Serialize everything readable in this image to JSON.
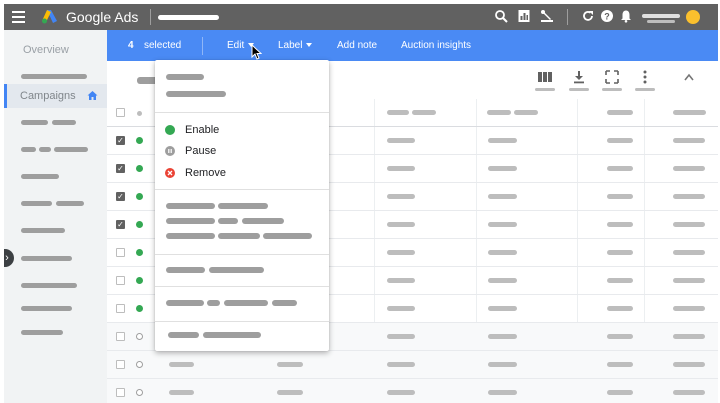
{
  "app": {
    "brand_name": "Google Ads"
  },
  "sidebar": {
    "overview_label": "Overview",
    "campaigns_label": "Campaigns"
  },
  "action_bar": {
    "selected_count": "4",
    "selected_label": "selected",
    "items": [
      "Edit",
      "Label",
      "Add note",
      "Auction insights"
    ]
  },
  "edit_menu": {
    "items": [
      {
        "label": "Enable",
        "icon": "enable-status-icon",
        "color": "#34a853"
      },
      {
        "label": "Pause",
        "icon": "pause-status-icon",
        "color": "#9e9e9e"
      },
      {
        "label": "Remove",
        "icon": "remove-status-icon",
        "color": "#ea4335"
      }
    ]
  },
  "table": {
    "rows": [
      {
        "checked": true,
        "status": "enabled"
      },
      {
        "checked": true,
        "status": "enabled"
      },
      {
        "checked": true,
        "status": "enabled"
      },
      {
        "checked": true,
        "status": "enabled"
      },
      {
        "checked": false,
        "status": "enabled"
      },
      {
        "checked": false,
        "status": "enabled"
      },
      {
        "checked": false,
        "status": "enabled"
      },
      {
        "checked": false,
        "status": "removed"
      },
      {
        "checked": false,
        "status": "removed"
      },
      {
        "checked": false,
        "status": "removed"
      }
    ]
  },
  "colors": {
    "top_bar": "#616161",
    "action_bar": "#4a8af4",
    "sidebar": "#f1f3f4",
    "enabled_dot": "#34a853",
    "removed_dot": "#9e9e9e",
    "avatar": "#fbc02d"
  },
  "icons": {
    "topbar": [
      "menu-icon",
      "google-ads-logo-icon",
      "search-icon",
      "reports-icon",
      "tools-icon",
      "refresh-icon",
      "help-icon",
      "notifications-icon"
    ],
    "toolbar": [
      "columns-icon",
      "download-icon",
      "expand-icon",
      "more-icon",
      "collapse-chevron-icon"
    ]
  }
}
